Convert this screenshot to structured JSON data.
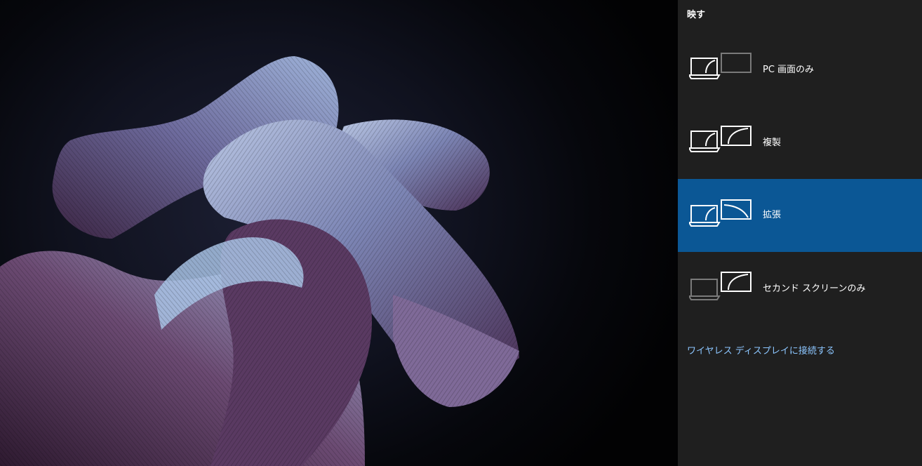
{
  "panel": {
    "title": "映す",
    "options": [
      {
        "label": "PC 画面のみ",
        "icon": "pc-screen-only-icon",
        "selected": false
      },
      {
        "label": "複製",
        "icon": "duplicate-icon",
        "selected": false
      },
      {
        "label": "拡張",
        "icon": "extend-icon",
        "selected": true
      },
      {
        "label": "セカンド スクリーンのみ",
        "icon": "second-screen-only-icon",
        "selected": false
      }
    ],
    "wireless_link": "ワイヤレス ディスプレイに接続する"
  },
  "colors": {
    "panel_bg": "#1f1f1f",
    "selected_bg": "#0b5795",
    "link": "#8cc6ff",
    "dim_icon": "#7a7a7a"
  }
}
